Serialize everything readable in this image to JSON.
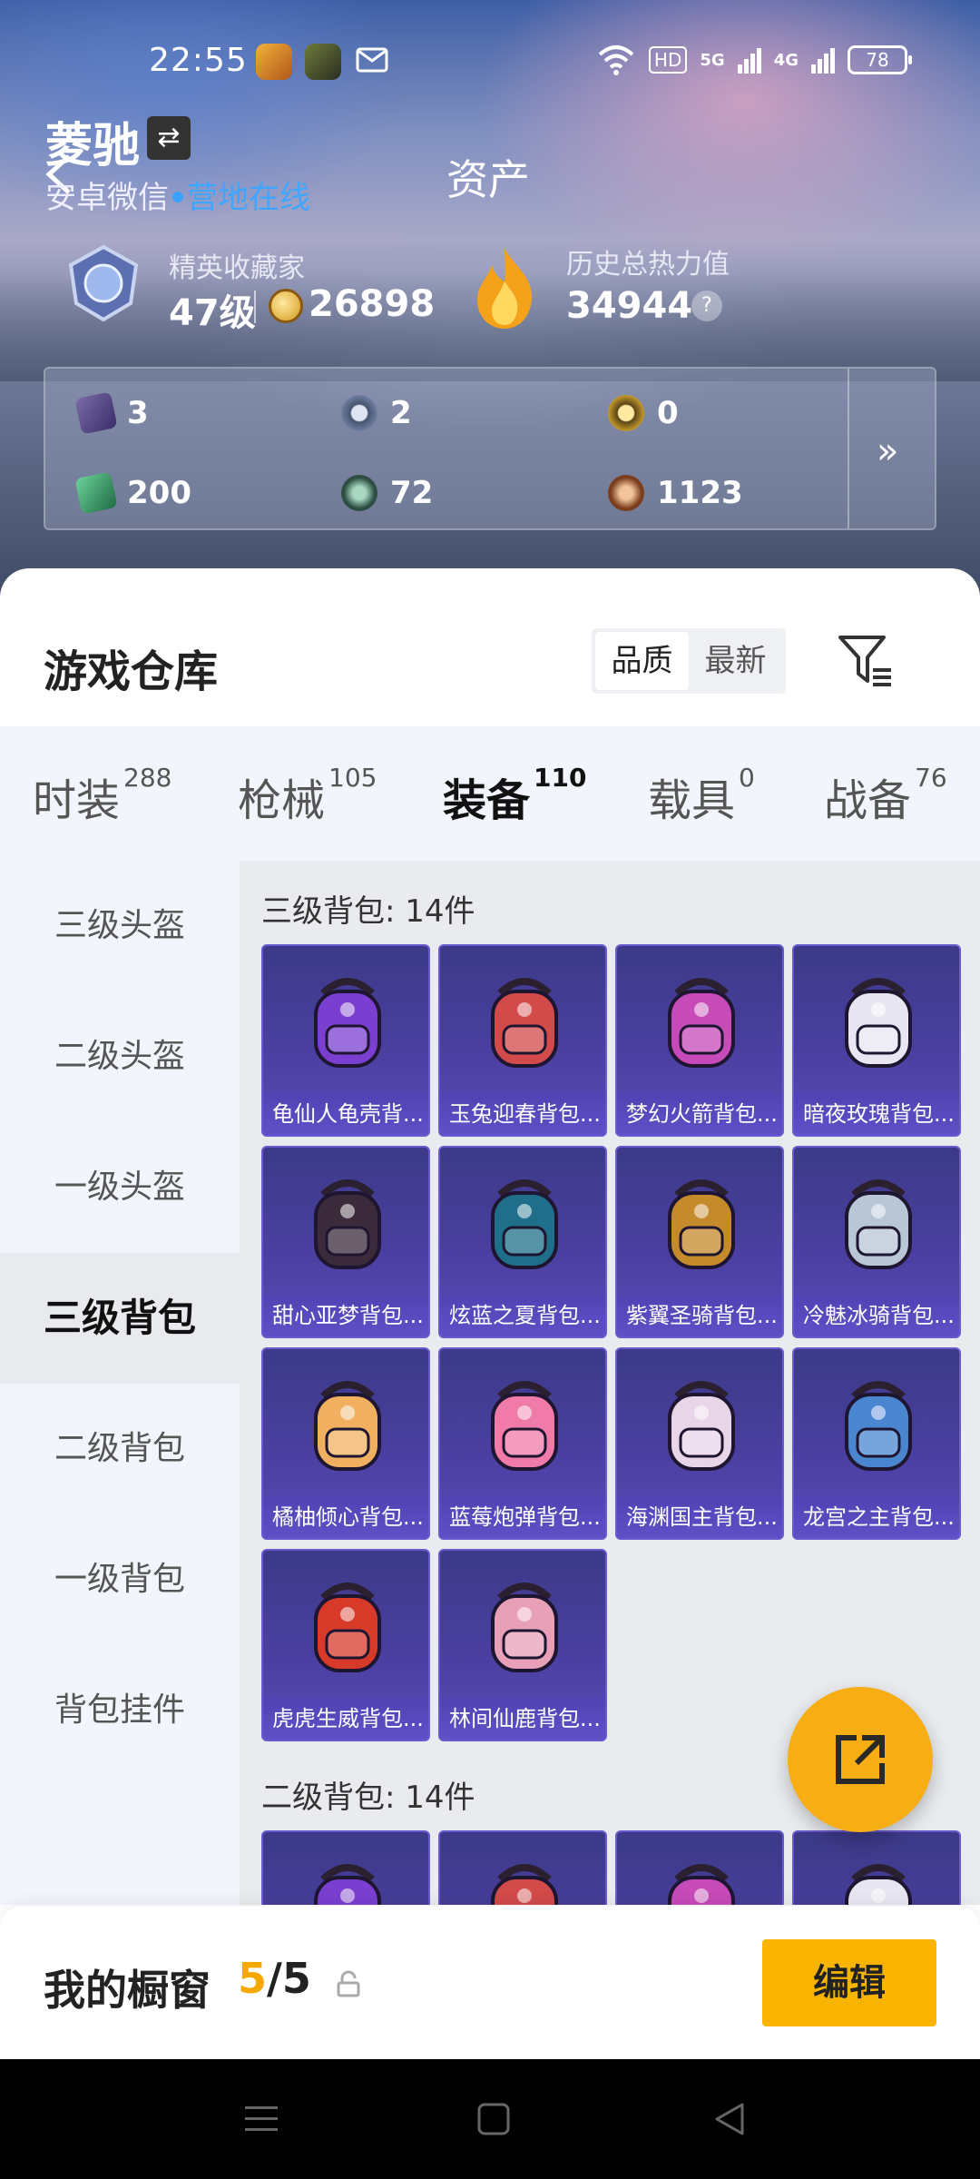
{
  "status_bar": {
    "time": "22:55",
    "hd_label": "HD",
    "net1": "5G",
    "net2": "4G",
    "battery": "78"
  },
  "header": {
    "profile_name": "菱驰",
    "platform": "安卓微信",
    "online_status": "营地在线",
    "page_title": "资产"
  },
  "stats": {
    "rank_title": "精英收藏家",
    "rank_level": "47级",
    "coin_value": "26898",
    "heat_title": "历史总热力值",
    "heat_value": "34944",
    "help": "?"
  },
  "resources": [
    {
      "value": "3",
      "icon": "purple-card-icon",
      "color": "#5a4a8a"
    },
    {
      "value": "2",
      "icon": "silver-medal-icon",
      "color": "#6f7ea0"
    },
    {
      "value": "0",
      "icon": "gold-medal-icon",
      "color": "#c49a2a"
    },
    {
      "value": "200",
      "icon": "green-ticket-icon",
      "color": "#3d9a68"
    },
    {
      "value": "72",
      "icon": "green-coin-icon",
      "color": "#4c7f6a"
    },
    {
      "value": "1123",
      "icon": "bronze-coin-icon",
      "color": "#a0603a"
    }
  ],
  "warehouse": {
    "title": "游戏仓库",
    "sort_options": [
      "品质",
      "最新"
    ],
    "active_sort": "品质"
  },
  "tabs": [
    {
      "label": "时装",
      "count": "288"
    },
    {
      "label": "枪械",
      "count": "105"
    },
    {
      "label": "装备",
      "count": "110"
    },
    {
      "label": "载具",
      "count": "0"
    },
    {
      "label": "战备",
      "count": "76"
    }
  ],
  "active_tab": "装备",
  "left_nav": [
    "三级头盔",
    "二级头盔",
    "一级头盔",
    "三级背包",
    "二级背包",
    "一级背包",
    "背包挂件"
  ],
  "active_nav": "三级背包",
  "sections": [
    {
      "title": "三级背包: 14件",
      "items": [
        {
          "name": "龟仙人龟壳背...",
          "color": "#7a3fd0"
        },
        {
          "name": "玉兔迎春背包...",
          "color": "#d24a4a"
        },
        {
          "name": "梦幻火箭背包...",
          "color": "#c64ab8"
        },
        {
          "name": "暗夜玫瑰背包...",
          "color": "#e8e6f0"
        },
        {
          "name": "甜心亚梦背包...",
          "color": "#3a2a3a"
        },
        {
          "name": "炫蓝之夏背包...",
          "color": "#1f6f8a"
        },
        {
          "name": "紫翼圣骑背包...",
          "color": "#c58a2a"
        },
        {
          "name": "冷魅冰骑背包...",
          "color": "#b8c6d6"
        },
        {
          "name": "橘柚倾心背包...",
          "color": "#f0b060"
        },
        {
          "name": "蓝莓炮弹背包...",
          "color": "#f07aa8"
        },
        {
          "name": "海渊国主背包...",
          "color": "#e8d6e8"
        },
        {
          "name": "龙宫之主背包...",
          "color": "#4a86d0"
        },
        {
          "name": "虎虎生威背包...",
          "color": "#d83a2a"
        },
        {
          "name": "林间仙鹿背包...",
          "color": "#e8a0b8"
        }
      ]
    },
    {
      "title": "二级背包: 14件",
      "items": [
        {
          "name": "",
          "color": "#7a3fd0"
        },
        {
          "name": "",
          "color": "#d24a4a"
        },
        {
          "name": "",
          "color": "#c64ab8"
        },
        {
          "name": "",
          "color": "#e8e6f0"
        }
      ]
    }
  ],
  "showcase": {
    "title": "我的橱窗",
    "current": "5",
    "separator": "/",
    "total": "5",
    "edit_label": "编辑"
  }
}
